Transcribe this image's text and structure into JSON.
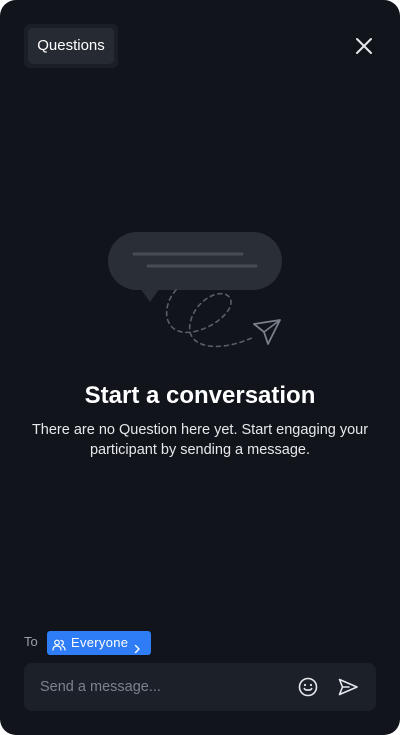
{
  "header": {
    "tab_label": "Questions",
    "close_icon": "close-icon"
  },
  "empty_state": {
    "illustration": "chat-bubble-paper-plane",
    "title": "Start a conversation",
    "description": "There are no Question here yet. Start engaging your participant by sending a message."
  },
  "recipient": {
    "to_label": "To",
    "selected": "Everyone",
    "icon": "users-icon"
  },
  "composer": {
    "placeholder": "Send a message...",
    "value": "",
    "emoji_icon": "smiley-icon",
    "send_icon": "send-icon"
  },
  "colors": {
    "background": "#11141b",
    "accent": "#2e7cf6",
    "input_bg": "#1c2029",
    "tab_bg": "#262a33"
  }
}
